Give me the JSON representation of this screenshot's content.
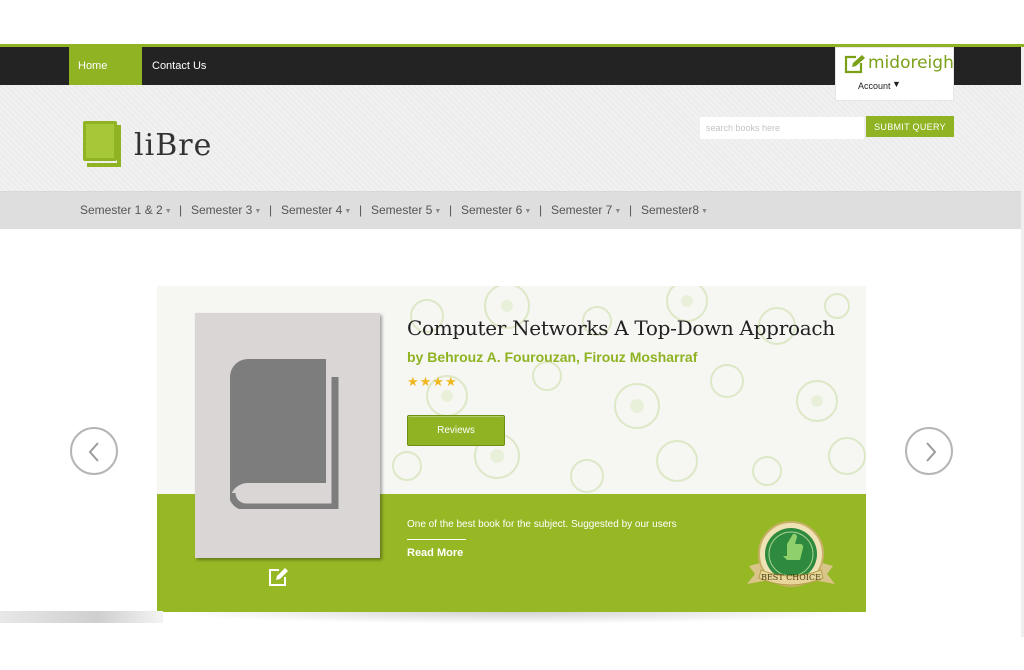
{
  "top_nav": {
    "items": [
      {
        "label": "Home page",
        "active": true
      },
      {
        "label": "Contact Us",
        "active": false
      }
    ]
  },
  "account": {
    "username": "midoreigh",
    "menu_label": "Account",
    "icon": "edit-square-icon"
  },
  "brand": {
    "name": "liBre",
    "icon": "book-logo-icon"
  },
  "search": {
    "placeholder": "search books here",
    "button_label": "SUBMIT QUERY"
  },
  "semesters": [
    {
      "label": "Semester 1 & 2"
    },
    {
      "label": "Semester 3"
    },
    {
      "label": "Semester 4"
    },
    {
      "label": "Semester 5"
    },
    {
      "label": "Semester 6"
    },
    {
      "label": "Semester 7"
    },
    {
      "label": "Semester8"
    }
  ],
  "separator": "|",
  "slide": {
    "title": "Computer Networks A Top-Down Approach",
    "author": "by Behrouz A. Fourouzan, Firouz Mosharraf",
    "rating": 4,
    "rating_max": 4,
    "stars_text": "★★★★",
    "reviews_label": "Reviews",
    "description": "One of the best book for the subject. Suggested by our users",
    "read_more_label": "Read More",
    "badge_text": "BEST CHOICE",
    "cover_icon": "book-icon",
    "edit_icon": "edit-icon"
  },
  "carousel": {
    "prev_icon": "chevron-left-icon",
    "next_icon": "chevron-right-icon"
  },
  "colors": {
    "accent": "#8fb322",
    "topbar": "#232323",
    "slide_green": "#97b825",
    "star": "#f0b820"
  }
}
